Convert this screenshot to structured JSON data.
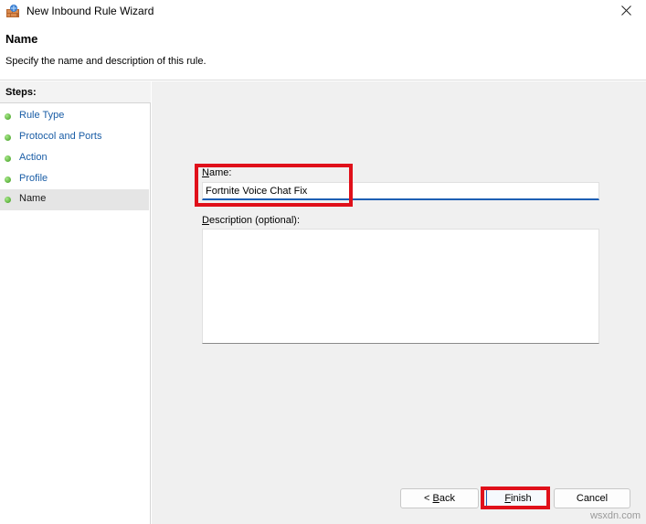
{
  "window": {
    "title": "New Inbound Rule Wizard"
  },
  "header": {
    "title": "Name",
    "description": "Specify the name and description of this rule."
  },
  "steps": {
    "heading": "Steps:",
    "items": [
      {
        "label": "Rule Type"
      },
      {
        "label": "Protocol and Ports"
      },
      {
        "label": "Action"
      },
      {
        "label": "Profile"
      },
      {
        "label": "Name",
        "current": true
      }
    ]
  },
  "form": {
    "name_label": "Name:",
    "name_value": "Fortnite Voice Chat Fix",
    "description_label": "Description (optional):",
    "description_value": ""
  },
  "buttons": {
    "back": "< Back",
    "finish": "Finish",
    "cancel": "Cancel"
  },
  "watermark": "wsxdn.com",
  "colors": {
    "highlight": "#e0101a",
    "step_dot": "#3c9a1c",
    "link": "#1a5da6",
    "accent": "#1e5fb4"
  }
}
